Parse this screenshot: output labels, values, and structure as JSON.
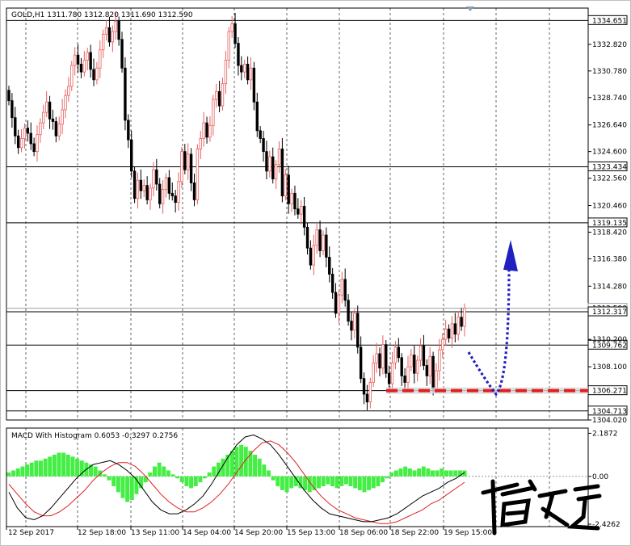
{
  "chart_data": {
    "type": "candlestick",
    "header": "GOLD,H1  1311.780 1312.820 1311.690 1312.590",
    "symbol": "GOLD,H1",
    "ohlc_header": {
      "open": 1311.78,
      "high": 1312.82,
      "low": 1311.69,
      "close": 1312.59
    },
    "price_ylim": [
      1304.02,
      1335.6
    ],
    "price_ticks": [
      "1332.820",
      "1330.780",
      "1328.740",
      "1326.640",
      "1324.600",
      "1322.560",
      "1320.460",
      "1318.420",
      "1316.380",
      "1314.280",
      "1310.200",
      "1308.100",
      "1304.020"
    ],
    "x_time_labels": [
      "12 Sep 2017",
      "12 Sep 18:00",
      "13 Sep 11:00",
      "14 Sep 04:00",
      "14 Sep 20:00",
      "15 Sep 13:00",
      "18 Sep 06:00",
      "18 Sep 22:00",
      "19 Sep 15:00"
    ],
    "levels": [
      {
        "value": 1334.651,
        "label": "1334.651"
      },
      {
        "value": 1323.434,
        "label": "1323.434"
      },
      {
        "value": 1319.135,
        "label": "1319.135"
      },
      {
        "value": 1312.317,
        "label": "1312.317"
      },
      {
        "value": 1309.762,
        "label": "1309.762"
      },
      {
        "value": 1306.271,
        "label": "1306.271"
      },
      {
        "value": 1304.713,
        "label": "1304.713"
      }
    ],
    "bid_line": {
      "value": 1312.59,
      "label": "1312.590"
    },
    "support_zone": {
      "value": 1306.271,
      "color": "#e02020"
    },
    "close_path": [
      1328.5,
      1327.2,
      1325.8,
      1324.9,
      1325.6,
      1326.4,
      1326.0,
      1325.2,
      1324.6,
      1325.9,
      1326.8,
      1327.6,
      1328.4,
      1327.1,
      1326.9,
      1325.8,
      1326.7,
      1327.8,
      1328.9,
      1329.6,
      1331.2,
      1332.0,
      1331.3,
      1330.7,
      1331.6,
      1332.2,
      1330.9,
      1330.1,
      1331.0,
      1332.4,
      1333.6,
      1334.1,
      1333.0,
      1333.8,
      1334.6,
      1333.2,
      1331.0,
      1327.0,
      1325.5,
      1323.1,
      1321.0,
      1322.4,
      1321.6,
      1322.0,
      1320.9,
      1321.8,
      1323.2,
      1322.1,
      1320.6,
      1321.7,
      1322.6,
      1321.4,
      1321.2,
      1320.7,
      1322.3,
      1324.6,
      1323.2,
      1324.4,
      1322.2,
      1320.9,
      1324.8,
      1325.6,
      1326.8,
      1325.7,
      1326.6,
      1328.6,
      1329.2,
      1328.1,
      1329.8,
      1331.6,
      1333.8,
      1334.4,
      1332.9,
      1331.2,
      1330.7,
      1331.3,
      1330.1,
      1331.0,
      1328.4,
      1326.2,
      1325.6,
      1324.6,
      1323.1,
      1324.2,
      1322.5,
      1323.6,
      1324.8,
      1321.2,
      1322.8,
      1320.6,
      1321.4,
      1320.2,
      1319.8,
      1320.4,
      1318.8,
      1317.2,
      1315.9,
      1317.4,
      1318.6,
      1317.0,
      1318.2,
      1316.5,
      1315.2,
      1313.8,
      1312.2,
      1313.6,
      1314.8,
      1313.2,
      1311.6,
      1310.9,
      1312.2,
      1309.6,
      1307.2,
      1306.0,
      1305.4,
      1306.9,
      1308.4,
      1309.1,
      1308.0,
      1309.8,
      1307.6,
      1306.8,
      1308.4,
      1309.6,
      1308.8,
      1307.4,
      1306.9,
      1308.1,
      1309.0,
      1307.6,
      1308.6,
      1309.7,
      1308.2,
      1307.4,
      1308.9,
      1306.4,
      1307.8,
      1309.4,
      1310.2,
      1311.0,
      1310.3,
      1311.4,
      1310.6,
      1311.9,
      1311.2,
      1312.6
    ],
    "macd": {
      "title": "MACD With Histogram 0.6053 -0.3297 0.2756",
      "values": {
        "macd": 0.6053,
        "signal": -0.3297,
        "histogram": 0.2756
      },
      "ticks": [
        "2.1872",
        "0.00",
        "-2.4262"
      ],
      "ylim": [
        -2.55,
        2.45
      ],
      "macd_line": [
        -0.8,
        -1.6,
        -2.1,
        -2.2,
        -2.0,
        -1.6,
        -1.1,
        -0.6,
        -0.1,
        0.3,
        0.6,
        0.7,
        0.8,
        0.6,
        0.3,
        -0.1,
        -0.7,
        -1.3,
        -1.7,
        -1.9,
        -1.9,
        -1.7,
        -1.4,
        -1.0,
        -0.4,
        0.3,
        1.0,
        1.6,
        2.0,
        2.1,
        1.9,
        1.6,
        1.1,
        0.5,
        -0.1,
        -0.7,
        -1.2,
        -1.6,
        -1.9,
        -2.0,
        -2.1,
        -2.2,
        -2.3,
        -2.3,
        -2.2,
        -2.1,
        -1.9,
        -1.6,
        -1.3,
        -1.0,
        -0.8,
        -0.6,
        -0.3,
        -0.1,
        0.2
      ],
      "signal_line": [
        -0.4,
        -0.9,
        -1.4,
        -1.8,
        -2.0,
        -2.0,
        -1.8,
        -1.5,
        -1.1,
        -0.7,
        -0.2,
        0.2,
        0.5,
        0.7,
        0.7,
        0.5,
        0.1,
        -0.4,
        -0.9,
        -1.3,
        -1.6,
        -1.8,
        -1.8,
        -1.6,
        -1.3,
        -0.9,
        -0.4,
        0.2,
        0.8,
        1.3,
        1.7,
        1.8,
        1.6,
        1.2,
        0.7,
        0.1,
        -0.5,
        -1.0,
        -1.4,
        -1.7,
        -1.9,
        -2.1,
        -2.2,
        -2.3,
        -2.4,
        -2.4,
        -2.3,
        -2.1,
        -1.9,
        -1.7,
        -1.4,
        -1.2,
        -0.9,
        -0.6,
        -0.3
      ],
      "histogram": [
        0.2,
        0.3,
        0.4,
        0.5,
        0.6,
        0.7,
        0.8,
        0.8,
        0.9,
        1.0,
        1.1,
        1.2,
        1.2,
        1.1,
        1.0,
        0.9,
        0.8,
        0.7,
        0.6,
        0.5,
        0.3,
        0.1,
        -0.2,
        -0.5,
        -0.8,
        -1.1,
        -1.3,
        -1.2,
        -0.9,
        -0.6,
        -0.3,
        0.2,
        0.5,
        0.7,
        0.5,
        0.3,
        0.1,
        -0.1,
        -0.3,
        -0.5,
        -0.6,
        -0.5,
        -0.3,
        -0.1,
        0.2,
        0.5,
        0.7,
        0.9,
        1.1,
        1.3,
        1.5,
        1.6,
        1.5,
        1.3,
        1.1,
        0.9,
        0.6,
        0.3,
        -0.2,
        -0.5,
        -0.7,
        -0.8,
        -0.6,
        -0.5,
        -0.6,
        -0.7,
        -0.8,
        -0.7,
        -0.6,
        -0.5,
        -0.4,
        -0.5,
        -0.6,
        -0.5,
        -0.4,
        -0.5,
        -0.6,
        -0.7,
        -0.8,
        -0.7,
        -0.6,
        -0.5,
        -0.3,
        -0.1,
        0.2,
        0.3,
        0.4,
        0.5,
        0.4,
        0.3,
        0.4,
        0.5,
        0.4,
        0.3,
        0.3,
        0.4,
        0.3,
        0.3,
        0.3,
        0.3,
        0.3
      ]
    },
    "colors": {
      "bull": "#e86060",
      "bear": "#000000",
      "macd_hist": "#44ee44",
      "signal": "#e02020",
      "macd": "#000000",
      "arrow": "#2020c0",
      "grid": "#000000"
    }
  }
}
